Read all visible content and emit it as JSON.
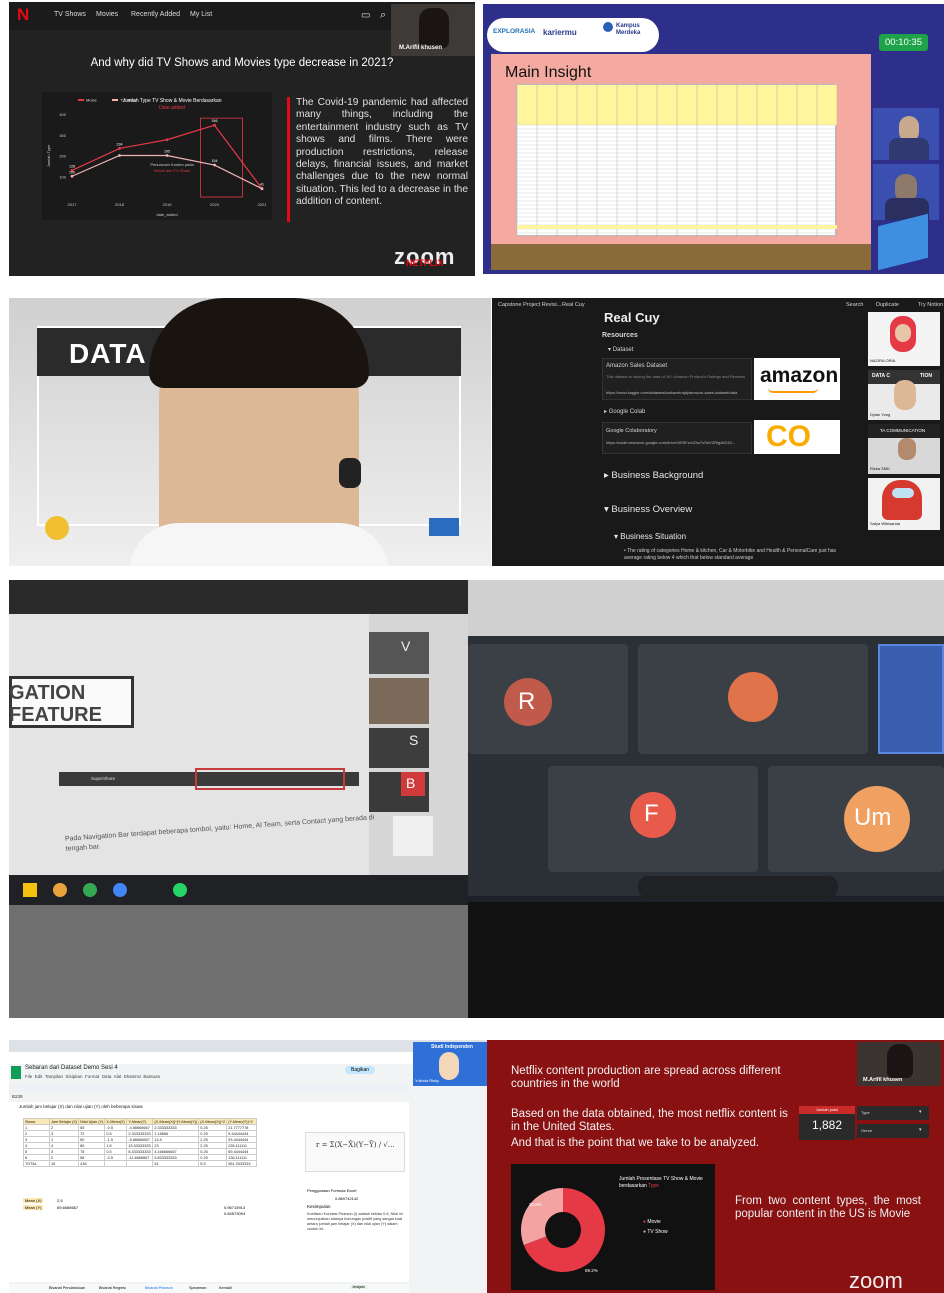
{
  "tile1": {
    "nav": [
      "TV Shows",
      "Movies",
      "Recently Added",
      "My List"
    ],
    "presenter": "M.Arifil khusen",
    "slide_title": "And why did TV Shows and Movies type decrease in 2021?",
    "body": "The Covid-19 pandemic had affected many things, including the entertainment industry such as TV shows and films. There were production restrictions, release delays, financial issues, and market challenges due to the new normal situation. This led to a decrease in the addition of content.",
    "zoom": "zoom",
    "netflix": "NETFLIX"
  },
  "chart_data": {
    "type": "line",
    "title": "Jumlah Type TV Show & Movie Berdasarkan",
    "title_highlight": "Date added",
    "xlabel": "date_added",
    "ylabel": "Jumlah Type",
    "x": [
      "2017",
      "2018",
      "2019",
      "2020",
      "2021"
    ],
    "ylim": [
      0,
      400
    ],
    "yticks": [
      "100",
      "200",
      "300",
      "400"
    ],
    "series": [
      {
        "name": "Movie",
        "values": [
          128,
          234,
          276,
          346,
          40
        ],
        "labels": [
          "128",
          "234",
          "",
          "346",
          "41"
        ],
        "color": "#e63946"
      },
      {
        "name": "TV Show",
        "values": [
          100,
          200,
          200,
          154,
          40
        ],
        "labels": [
          "100",
          "",
          "195",
          "154",
          ""
        ],
        "color": "#f0b4b4"
      }
    ],
    "annotation": "Penurunan Konten pada",
    "annotation_highlight": "Movie dan TV Show",
    "legend": "top-left"
  },
  "tile2": {
    "logos": [
      "EXPLORASIA",
      "kariermu",
      "Kampus Merdeka"
    ],
    "timer": "00:10:35",
    "title": "Main Insight"
  },
  "tile3": {
    "banner": "DATA C          ATION"
  },
  "tile4": {
    "topbar_title": "Capstone Project Revisi...",
    "topbar_page": "Real Cuy",
    "topbar_actions": [
      "Search",
      "Duplicate",
      "Try Notion"
    ],
    "page_heading": "Real Cuy",
    "resources": "Resources",
    "dataset": "Dataset",
    "amazon_title": "Amazon Sales Dataset",
    "amazon_desc": "This dataset is having the data of 1K+ Amazon Product's Ratings and Reviews",
    "amazon_url": "https://www.kaggle.com/datasets/karkavelrajaj/amazon-sales-dataset/data",
    "amazon_logo": "amazon",
    "colab_toggle": "Google Colab",
    "colab_title": "Google Colaboratory",
    "colab_url": "https://colab.research.google.com/drive/1IE5Fzr1Zhu7xSeVZRlgdK242...",
    "colab_logo": "CO",
    "business_background": "Business Background",
    "business_overview": "Business Overview",
    "business_situation": "Business Situation",
    "bullet": "The rating of categories Home & kitchen, Car & Motorbike and Health & PersonalCare just has average rating below 4 which that below standard average",
    "participants": [
      "NAZIRA ORIA",
      "Dylan Yong",
      "Rizka SMK",
      "Satya Wibisanda"
    ],
    "tile_text": "DATA C",
    "tile_text2": "TION",
    "tile_text3": "TA COMMUNICATION"
  },
  "tile5": {
    "slide_line1": "GATION",
    "slide_line2": "FEATURE",
    "caption": "Pada Navigation Bar terdapat beberapa tombol, yaitu: Home, Al Team, serta Contact yang berada di tengah bar.",
    "brand": "SuperShore",
    "letters": [
      "V",
      "S",
      "B"
    ]
  },
  "tile6": {
    "avatars": [
      "R",
      "F",
      "Um"
    ]
  },
  "tile7": {
    "title": "Sebaran dari Dataset Demo Sesi 4",
    "menu": [
      "File",
      "Edit",
      "Tampilan",
      "Sisipkan",
      "Format",
      "Data",
      "Alat",
      "Ekstensi",
      "Bantuan"
    ],
    "cell_ref": "B239",
    "share": "Bagikan",
    "note": "Jumlah jam belajar (X) dan nilai ujian (Y) oleh beberapa siswa",
    "headers": [
      "Siswa",
      "Jam Belajar (X)",
      "Nilai Ujian (Y)",
      "X-Mean(X)",
      "Y-Mean(Y)",
      "(X-Mean(X))*(Y-Mean(Y))",
      "(X-Mean(X))^2",
      "(Y-Mean(Y))^2"
    ],
    "rows": [
      [
        "1",
        "2",
        "65",
        "-0.5",
        "-4.66666667",
        "2.333333333",
        "0.25",
        "21.7777778"
      ],
      [
        "2",
        "3",
        "72",
        "0.5",
        "2.333333333",
        "1.16666",
        "0.25",
        "5.44444444"
      ],
      [
        "3",
        "1",
        "60",
        "-1.5",
        "-9.66666667",
        "14.5",
        "2.25",
        "93.4444444"
      ],
      [
        "4",
        "4",
        "85",
        "1.5",
        "15.33333333",
        "23",
        "2.25",
        "235.111111"
      ],
      [
        "5",
        "3",
        "78",
        "0.5",
        "8.333333333",
        "4.166666667",
        "0.25",
        "69.4444444"
      ],
      [
        "6",
        "2",
        "58",
        "-0.5",
        "-11.6666667",
        "5.833333333",
        "0.25",
        "136.111111"
      ]
    ],
    "total": [
      "TOTAL",
      "15",
      "418",
      "",
      "",
      "51",
      "5.5",
      "561.3333333"
    ],
    "mean_x_label": "Mean (X)",
    "mean_x": "2.5",
    "mean_y_label": "Mean (Y)",
    "mean_y": "69.6666667",
    "right_values": [
      "0.96715913",
      "0.84573094"
    ],
    "formula_label": "Penggunaan Formula Excel",
    "formula_val": "0.869742142",
    "kesimpulan": "Kesimpulan",
    "conclusion": "Koefisien Korelasi Pearson (r) adalah sekitar 0.8, Nilai ini menunjukkan adanya hubungan positif yang sangat kuat antara jumlah jam belajar (X) dan nilai ujian (Y) dalam contoh ini.",
    "participant": "Yulinda Risky",
    "banner": "Studi Independen",
    "sheets": [
      "Bivariat Pendahuluan",
      "Bivariat Regresi",
      "Bivariat Pearson",
      "Spearman",
      "Kendall"
    ],
    "explore": "Jelajahi"
  },
  "tile8": {
    "line1": "Netflix content production are spread across different countries in the world",
    "line2": "Based on the data obtained, the most netflix content is in the United States.",
    "line3": "And that is the point that we take to be analyzed.",
    "box_label": "Jumlah judul",
    "box_value": "1,882",
    "dropdowns": [
      "Type",
      "Genre"
    ],
    "chart_title": "Jumlah Prosentase TV Show & Movie berdasarkan",
    "chart_title_hl": "Type",
    "pct_tv": "30.8%",
    "pct_movie": "69.2%",
    "legend_movie": "Movie",
    "legend_tv": "TV Show",
    "right_text": "From two content types, the most popular content in the US is Movie",
    "zoom": "zoom",
    "presenter": "M.Arifil khusen"
  },
  "colors": {
    "netflix_red": "#e50914",
    "slide_red": "#891111",
    "zoom_navy": "#2d2f8a",
    "timer_green": "#1fa34a"
  },
  "pie_data": {
    "type": "pie",
    "labels": [
      "Movie",
      "TV Show"
    ],
    "values": [
      69.2,
      30.8
    ]
  }
}
